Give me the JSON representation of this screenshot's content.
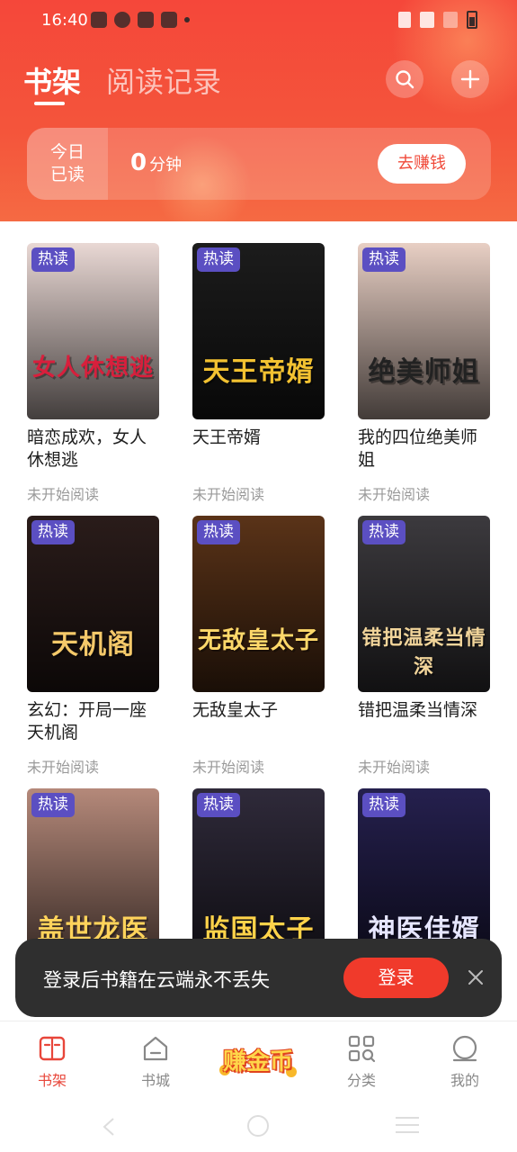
{
  "status_bar": {
    "time": "16:40"
  },
  "header": {
    "tabs": [
      {
        "label": "书架",
        "active": true
      },
      {
        "label": "阅读记录",
        "active": false
      }
    ],
    "search_icon": "search-icon",
    "add_icon": "plus-icon",
    "today_read": {
      "label_line1": "今日",
      "label_line2": "已读",
      "value": "0",
      "unit": "分钟",
      "earn_button": "去赚钱"
    }
  },
  "books": [
    {
      "title": "暗恋成欢，女人休想逃",
      "status": "未开始阅读",
      "badge": "热读",
      "cover_text": "女人休想逃",
      "cover_bg": "#e9d8d4",
      "cover_text_color": "#d81f3c"
    },
    {
      "title": "天王帝婿",
      "status": "未开始阅读",
      "badge": "热读",
      "cover_text": "天王帝婿",
      "cover_bg": "#1c1c1c",
      "cover_text_color": "#f3c231"
    },
    {
      "title": "我的四位绝美师姐",
      "status": "未开始阅读",
      "badge": "热读",
      "cover_text": "绝美师姐",
      "cover_bg": "#e8cfc4",
      "cover_text_color": "#222222"
    },
    {
      "title": "玄幻：开局一座天机阁",
      "status": "未开始阅读",
      "badge": "热读",
      "cover_text": "天机阁",
      "cover_bg": "#2a1c1a",
      "cover_text_color": "#f5c96a"
    },
    {
      "title": "无敌皇太子",
      "status": "未开始阅读",
      "badge": "热读",
      "cover_text": "无敌皇太子",
      "cover_bg": "#5a3318",
      "cover_text_color": "#ffd86a"
    },
    {
      "title": "错把温柔当情深",
      "status": "未开始阅读",
      "badge": "热读",
      "cover_text": "错把温柔当情深",
      "cover_bg": "#3c3a3e",
      "cover_text_color": "#f1d49a"
    },
    {
      "title": "",
      "status": "",
      "badge": "热读",
      "cover_text": "盖世龙医",
      "cover_bg": "#b5897a",
      "cover_text_color": "#ffd35b"
    },
    {
      "title": "",
      "status": "",
      "badge": "热读",
      "cover_text": "监国太子",
      "cover_bg": "#2f2a3a",
      "cover_text_color": "#ffd34a"
    },
    {
      "title": "",
      "status": "",
      "badge": "热读",
      "cover_text": "神医佳婿",
      "cover_bg": "#25204e",
      "cover_text_color": "#e6e6ff"
    }
  ],
  "toast": {
    "message": "登录后书籍在云端永不丢失",
    "login_button": "登录",
    "close_icon": "close-icon"
  },
  "bottom_nav": [
    {
      "label": "书架",
      "icon": "bookshelf-icon",
      "active": true
    },
    {
      "label": "书城",
      "icon": "home-icon",
      "active": false
    },
    {
      "label": "赚金币",
      "icon": "earn-coins-icon",
      "active": false
    },
    {
      "label": "分类",
      "icon": "category-icon",
      "active": false
    },
    {
      "label": "我的",
      "icon": "profile-icon",
      "active": false
    }
  ],
  "colors": {
    "accent": "#f04a3a",
    "badge": "#5b4fc2"
  }
}
